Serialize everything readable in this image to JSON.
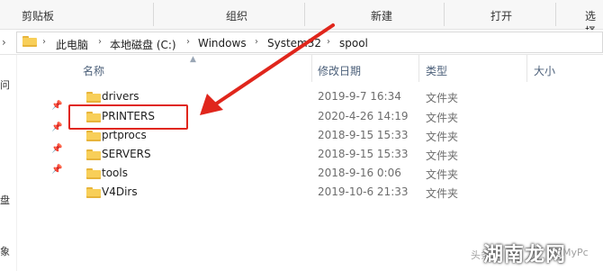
{
  "ribbon": {
    "groups": [
      "剪贴板",
      "组织",
      "新建",
      "打开",
      "选择"
    ]
  },
  "address": {
    "crumbs": [
      "此电脑",
      "本地磁盘 (C:)",
      "Windows",
      "System32",
      "spool"
    ]
  },
  "nav_pane": {
    "chars": [
      "问",
      "盘",
      "象"
    ]
  },
  "columns": {
    "name": "名称",
    "modified": "修改日期",
    "type": "类型",
    "size": "大小"
  },
  "files": [
    {
      "name": "drivers",
      "modified": "2019-9-7 16:34",
      "type": "文件夹"
    },
    {
      "name": "PRINTERS",
      "modified": "2020-4-26 14:19",
      "type": "文件夹"
    },
    {
      "name": "prtprocs",
      "modified": "2018-9-15 15:33",
      "type": "文件夹"
    },
    {
      "name": "SERVERS",
      "modified": "2018-9-15 15:33",
      "type": "文件夹"
    },
    {
      "name": "tools",
      "modified": "2018-9-16 0:06",
      "type": "文件夹"
    },
    {
      "name": "V4Dirs",
      "modified": "2019-10-6 21:33",
      "type": "文件夹"
    }
  ],
  "highlight": {
    "target": "PRINTERS",
    "color": "#e0261c"
  },
  "watermark": {
    "prefix": "头条",
    "main": "湖南龙网",
    "suffix": "gMyPc"
  },
  "icons": {
    "folder": "folder-icon",
    "pin": "pin-icon",
    "chevron": "chevron-right-icon",
    "sort": "sort-up-icon"
  }
}
